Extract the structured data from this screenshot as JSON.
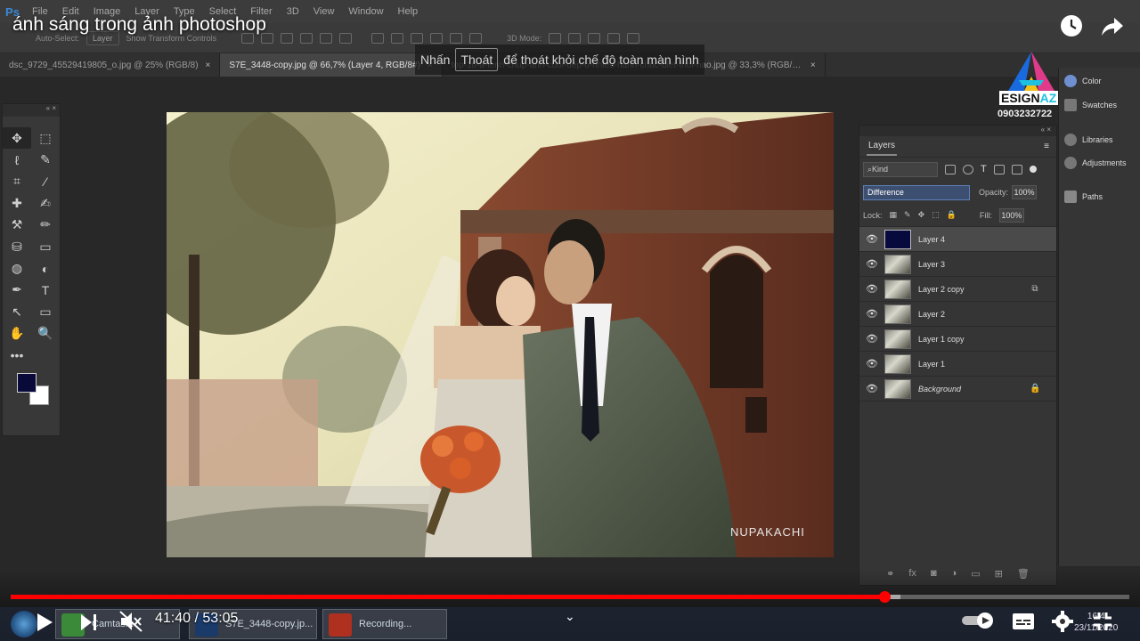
{
  "video": {
    "title": "ánh sáng trong ảnh photoshop",
    "time_current": "41:40",
    "time_total": "53:05",
    "progress": 0.781,
    "buffered": 0.795
  },
  "photoshop": {
    "menu": [
      "File",
      "Edit",
      "Image",
      "Layer",
      "Type",
      "Select",
      "Filter",
      "3D",
      "View",
      "Window",
      "Help"
    ],
    "options": {
      "auto_select": "Auto-Select:",
      "auto_select_value": "Layer",
      "show_transform": "Show Transform Controls",
      "mode": "3D Mode:"
    },
    "tabs": [
      {
        "label": "dsc_9729_45529419805_o.jpg @ 25% (RGB/8)",
        "close": "×"
      },
      {
        "label": "S7E_3448-copy.jpg @ 66,7% (Layer 4, RGB/8#)",
        "close": "×"
      },
      {
        "label": "top-10-a-lenh-chup-anh-cuoi-dep-o-nhieu-hanh-chuc-biet-thoi-nao.jpg @ 33,3% (RGB/8#)",
        "close": "×"
      }
    ],
    "toast": {
      "before": "Nhấn",
      "button": "Thoát",
      "after": "để thoát khỏi chế độ toàn màn hình"
    },
    "toolbox_header": "«  ×",
    "tools": [
      "✥",
      "⬚",
      "ℓ",
      "✎",
      "⌗",
      "⁄",
      "✚",
      "✍",
      "⚒",
      "✏",
      "⛁",
      "▭",
      "◍",
      "◐",
      "✒",
      "T",
      "↖",
      "▭",
      "✋",
      "🔍",
      "•••",
      ""
    ],
    "watermark": "NUPAKACHI"
  },
  "layers_panel": {
    "header": "«  ×",
    "title": "Layers",
    "menu_icon": "≡",
    "kind_label": "Kind",
    "blend_mode": "Difference",
    "opacity_label": "Opacity:",
    "opacity": "100%",
    "lock_label": "Lock:",
    "fill_label": "Fill:",
    "fill": "100%",
    "layers": [
      {
        "name": "Layer 4",
        "thumb": "navy",
        "selected": true,
        "badge": ""
      },
      {
        "name": "Layer 3",
        "thumb": "photo",
        "selected": false,
        "badge": ""
      },
      {
        "name": "Layer 2 copy",
        "thumb": "photo",
        "selected": false,
        "badge": "⧉"
      },
      {
        "name": "Layer 2",
        "thumb": "photo",
        "selected": false,
        "badge": ""
      },
      {
        "name": "Layer 1 copy",
        "thumb": "photo",
        "selected": false,
        "badge": ""
      },
      {
        "name": "Layer 1",
        "thumb": "photo",
        "selected": false,
        "badge": ""
      },
      {
        "name": "Background",
        "thumb": "photo",
        "selected": false,
        "badge": "🔒"
      }
    ],
    "footer_icons": [
      "⚭",
      "fx",
      "◙",
      "◑",
      "▭",
      "⊞",
      "🗑"
    ]
  },
  "side_panels": [
    {
      "label": "Color",
      "color": "#6f8fd0"
    },
    {
      "label": "Swatches",
      "color": "#aaaaaa"
    },
    {
      "label": "Libraries",
      "color": "#aaaaaa"
    },
    {
      "label": "Adjustments",
      "color": "#bbbbbb"
    },
    {
      "label": "Paths",
      "color": "#bbbbbb"
    }
  ],
  "logo": {
    "letters": "ESIGN",
    "suffix": "AZ",
    "phone": "0903232722"
  },
  "taskbar": {
    "tasks": [
      {
        "label": "Camtasia",
        "color": "#3a8a3a"
      },
      {
        "label": "S7E_3448-copy.jp...",
        "color": "#1a3a6a"
      },
      {
        "label": "Recording...",
        "color": "#b03020"
      }
    ],
    "time": "16:4",
    "date": "23/11/2020"
  },
  "colors": {
    "youtube_red": "#ff0000",
    "selected_blend": "#3d4f70"
  }
}
